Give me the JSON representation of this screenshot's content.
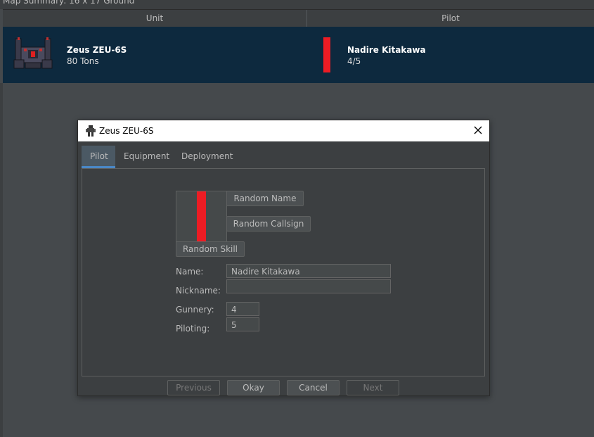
{
  "top_strip": {
    "text": "Map Summary: 16 x 17 Ground"
  },
  "table": {
    "columns": [
      "Unit",
      "Pilot"
    ],
    "row": {
      "unit_name": "Zeus ZEU-6S",
      "unit_tons": "80 Tons",
      "pilot_name": "Nadire Kitakawa",
      "pilot_skill": "4/5"
    }
  },
  "dialog": {
    "title": "Zeus ZEU-6S",
    "tabs": [
      "Pilot",
      "Equipment",
      "Deployment"
    ],
    "buttons": {
      "random_name": "Random Name",
      "random_callsign": "Random Callsign",
      "random_skill": "Random Skill"
    },
    "fields": {
      "name_label": "Name:",
      "name_value": "Nadire Kitakawa",
      "nickname_label": "Nickname:",
      "nickname_value": "",
      "gunnery_label": "Gunnery:",
      "gunnery_value": "4",
      "piloting_label": "Piloting:",
      "piloting_value": "5"
    },
    "footer": {
      "previous": "Previous",
      "okay": "Okay",
      "cancel": "Cancel",
      "next": "Next"
    }
  },
  "colors": {
    "accent": "#4a88c7",
    "selected_row": "#0d293e",
    "pilot_color": "#ed1c24"
  },
  "icons": {
    "unit": "mech-sprite",
    "title": "mech-icon",
    "close": "close-icon"
  }
}
